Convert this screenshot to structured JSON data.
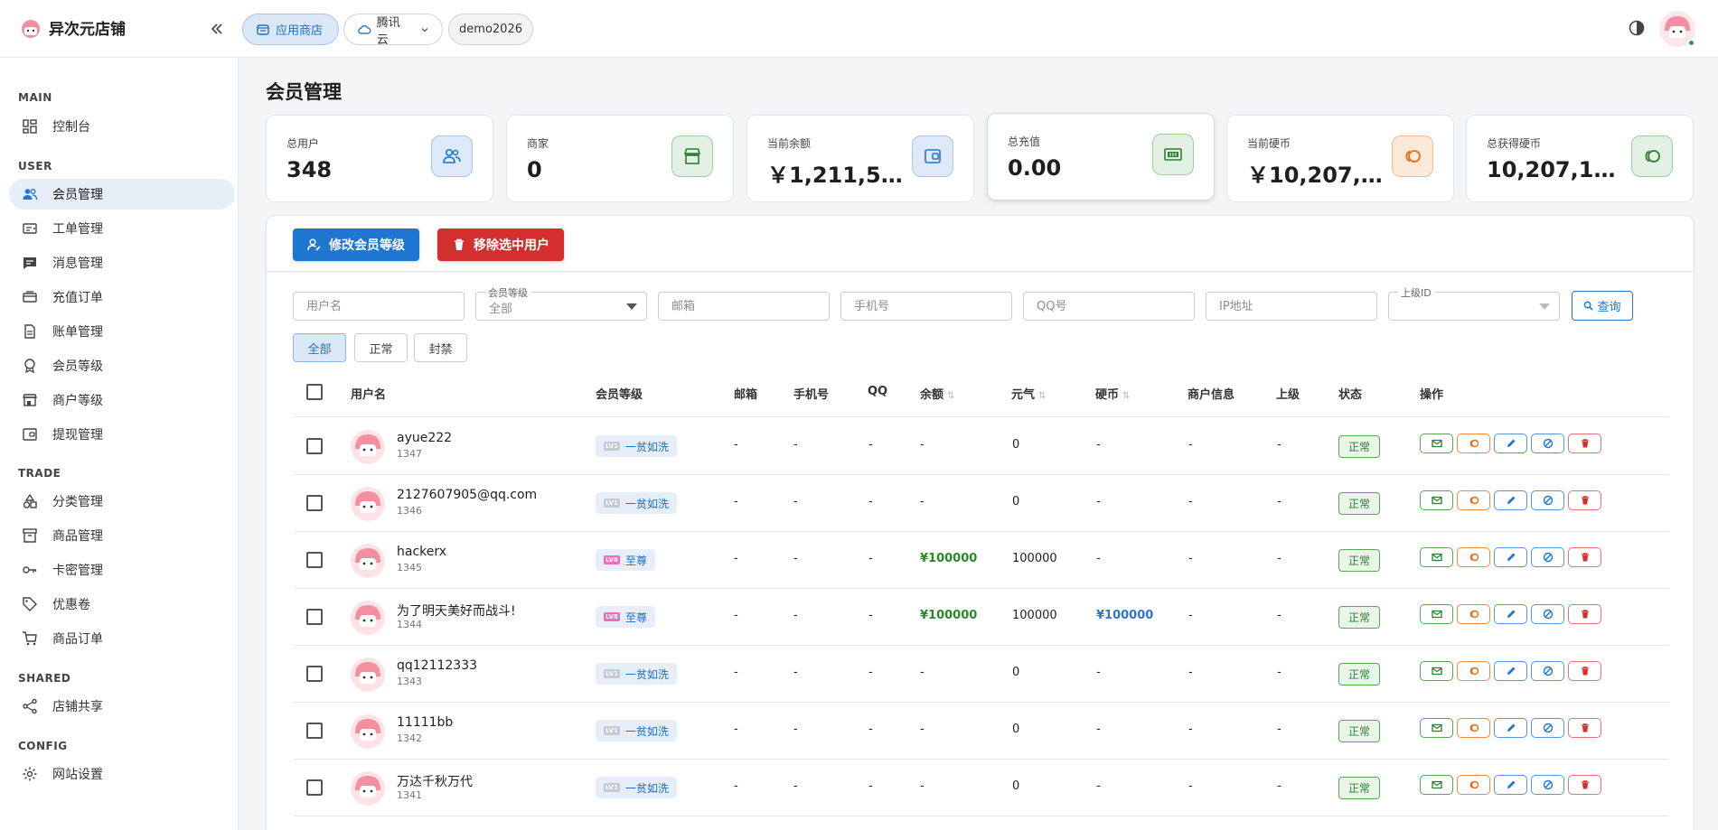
{
  "brand": {
    "name": "异次元店铺"
  },
  "topbar": {
    "chips": [
      {
        "label": "应用商店",
        "icon": "store-icon"
      },
      {
        "label": "腾讯云",
        "icon": "cloud-icon"
      },
      {
        "label": "demo2026"
      }
    ]
  },
  "sidebar": {
    "sections": [
      "MAIN",
      "USER",
      "TRADE",
      "SHARED",
      "CONFIG"
    ],
    "items": [
      {
        "label": "控制台"
      },
      {
        "label": "会员管理"
      },
      {
        "label": "工单管理"
      },
      {
        "label": "消息管理"
      },
      {
        "label": "充值订单"
      },
      {
        "label": "账单管理"
      },
      {
        "label": "会员等级"
      },
      {
        "label": "商户等级"
      },
      {
        "label": "提现管理"
      },
      {
        "label": "分类管理"
      },
      {
        "label": "商品管理"
      },
      {
        "label": "卡密管理"
      },
      {
        "label": "优惠卷"
      },
      {
        "label": "商品订单"
      },
      {
        "label": "店铺共享"
      },
      {
        "label": "网站设置"
      }
    ]
  },
  "page": {
    "title": "会员管理"
  },
  "stats": [
    {
      "label": "总用户",
      "value": "348",
      "color": "#1e76d0"
    },
    {
      "label": "商家",
      "value": "0",
      "color": "#2e7d32"
    },
    {
      "label": "当前余额",
      "value": "￥1,211,51...",
      "color": "#1e76d0"
    },
    {
      "label": "总充值",
      "value": "0.00",
      "color": "#2e7d32"
    },
    {
      "label": "当前硬币",
      "value": "￥10,207,1...",
      "color": "#ea6a14"
    },
    {
      "label": "总获得硬币",
      "value": "10,207,103...",
      "color": "#2e7d32"
    }
  ],
  "toolbar": {
    "edit_level": "修改会员等级",
    "remove_selected": "移除选中用户"
  },
  "filters": {
    "username": "用户名",
    "level_label": "会员等级",
    "level_value": "全部",
    "email": "邮箱",
    "phone": "手机号",
    "qq": "QQ号",
    "ip": "IP地址",
    "parent_label": "上级ID",
    "search": "查询"
  },
  "tabs": [
    "全部",
    "正常",
    "封禁"
  ],
  "table": {
    "headers": {
      "username": "用户名",
      "level": "会员等级",
      "email": "邮箱",
      "phone": "手机号",
      "qq": "QQ",
      "balance": "余额",
      "yuanqi": "元气",
      "coins": "硬币",
      "merchant": "商户信息",
      "parent": "上级",
      "status": "状态",
      "actions": "操作"
    },
    "rows": [
      {
        "name": "ayue222",
        "id": "1347",
        "level": "一贫如洗",
        "level_tag": "LV1",
        "email": "-",
        "phone": "-",
        "qq": "-",
        "balance": "-",
        "yuanqi": "0",
        "coins": "-",
        "merchant": "-",
        "parent": "-",
        "status": "正常"
      },
      {
        "name": "2127607905@qq.com",
        "id": "1346",
        "level": "一贫如洗",
        "level_tag": "LV1",
        "email": "-",
        "phone": "-",
        "qq": "-",
        "balance": "-",
        "yuanqi": "0",
        "coins": "-",
        "merchant": "-",
        "parent": "-",
        "status": "正常"
      },
      {
        "name": "hackerx",
        "id": "1345",
        "level": "至尊",
        "level_tag": "LV8",
        "email": "-",
        "phone": "-",
        "qq": "-",
        "balance": "¥100000",
        "yuanqi": "100000",
        "coins": "-",
        "merchant": "-",
        "parent": "-",
        "status": "正常"
      },
      {
        "name": "为了明天美好而战斗!",
        "id": "1344",
        "level": "至尊",
        "level_tag": "LV8",
        "email": "-",
        "phone": "-",
        "qq": "-",
        "balance": "¥100000",
        "yuanqi": "100000",
        "coins": "¥100000",
        "merchant": "-",
        "parent": "-",
        "status": "正常"
      },
      {
        "name": "qq12112333",
        "id": "1343",
        "level": "一贫如洗",
        "level_tag": "LV1",
        "email": "-",
        "phone": "-",
        "qq": "-",
        "balance": "-",
        "yuanqi": "0",
        "coins": "-",
        "merchant": "-",
        "parent": "-",
        "status": "正常"
      },
      {
        "name": "11111bb",
        "id": "1342",
        "level": "一贫如洗",
        "level_tag": "LV1",
        "email": "-",
        "phone": "-",
        "qq": "-",
        "balance": "-",
        "yuanqi": "0",
        "coins": "-",
        "merchant": "-",
        "parent": "-",
        "status": "正常"
      },
      {
        "name": "万达千秋万代",
        "id": "1341",
        "level": "一贫如洗",
        "level_tag": "LV1",
        "email": "-",
        "phone": "-",
        "qq": "-",
        "balance": "-",
        "yuanqi": "0",
        "coins": "-",
        "merchant": "-",
        "parent": "-",
        "status": "正常"
      }
    ]
  }
}
